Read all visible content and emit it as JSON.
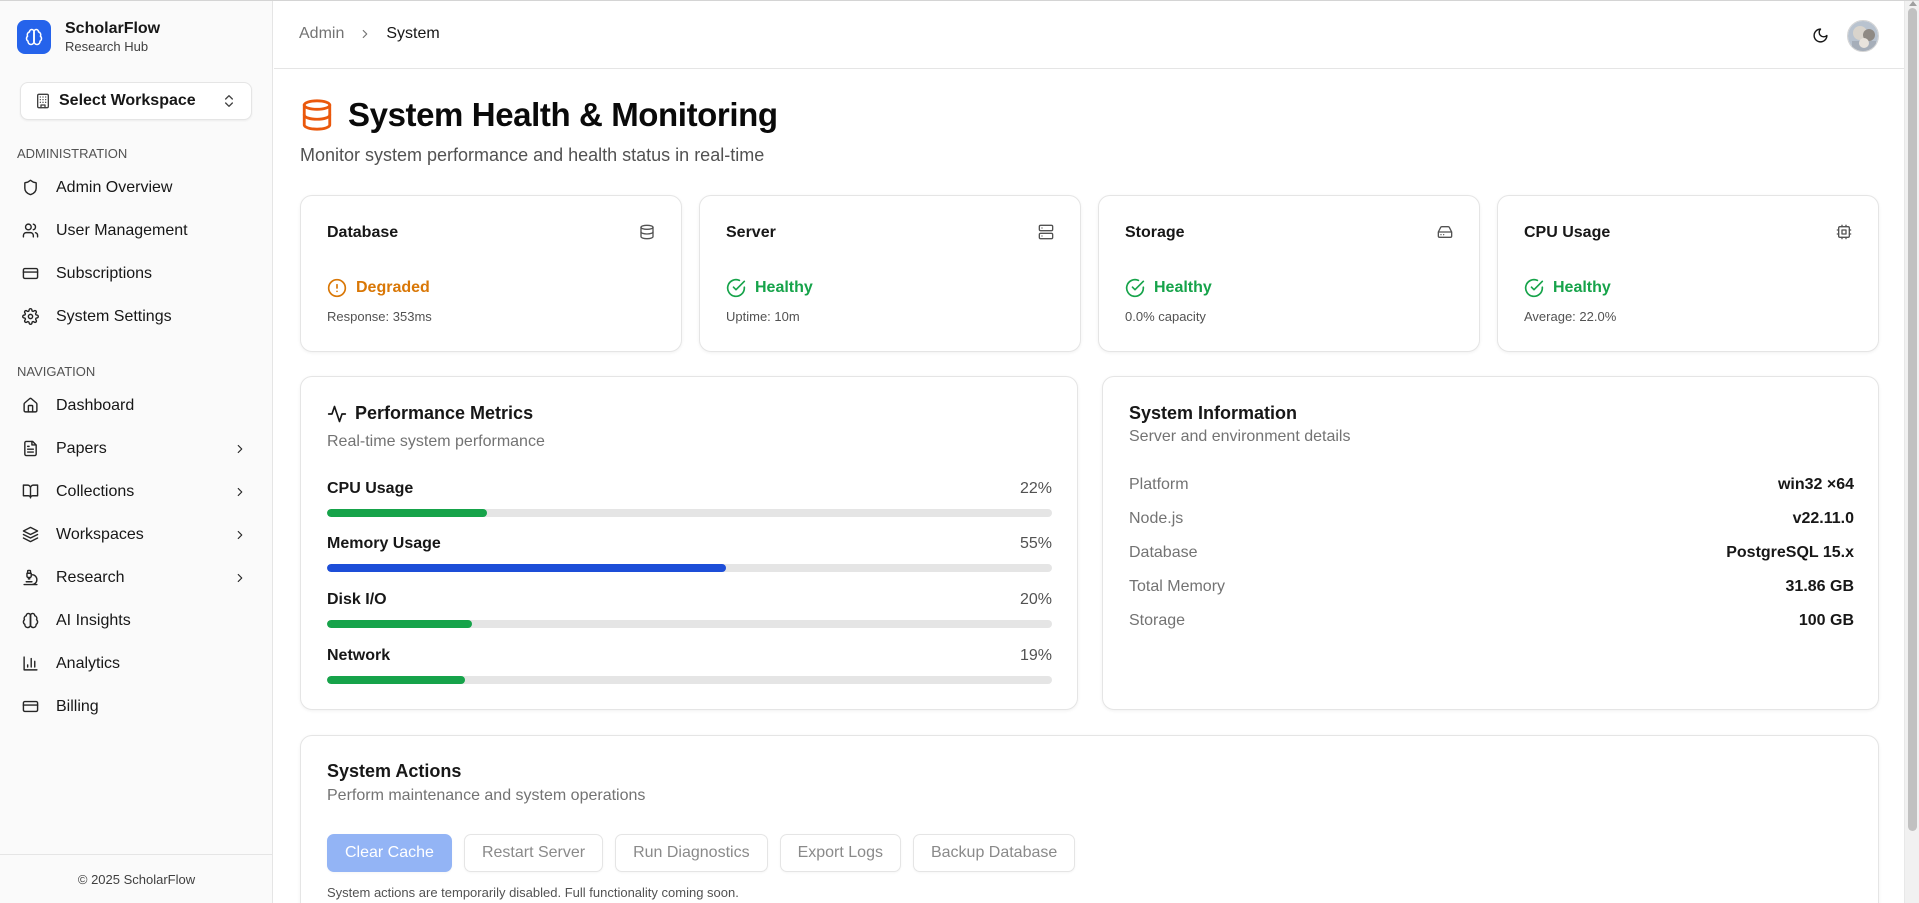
{
  "brand": {
    "name": "ScholarFlow",
    "subtitle": "Research Hub"
  },
  "workspace_select": {
    "label": "Select Workspace"
  },
  "sidebar": {
    "admin_label": "ADMINISTRATION",
    "admin_items": [
      {
        "label": "Admin Overview",
        "icon": "shield-icon"
      },
      {
        "label": "User Management",
        "icon": "users-icon"
      },
      {
        "label": "Subscriptions",
        "icon": "credit-card-icon"
      },
      {
        "label": "System Settings",
        "icon": "gear-icon"
      }
    ],
    "nav_label": "NAVIGATION",
    "nav_items": [
      {
        "label": "Dashboard",
        "icon": "home-icon"
      },
      {
        "label": "Papers",
        "icon": "file-text-icon",
        "expandable": true
      },
      {
        "label": "Collections",
        "icon": "book-open-icon",
        "expandable": true
      },
      {
        "label": "Workspaces",
        "icon": "layers-icon",
        "expandable": true
      },
      {
        "label": "Research",
        "icon": "microscope-icon",
        "expandable": true
      },
      {
        "label": "AI Insights",
        "icon": "brain-icon"
      },
      {
        "label": "Analytics",
        "icon": "bar-chart-icon"
      },
      {
        "label": "Billing",
        "icon": "credit-card-icon"
      }
    ],
    "footer": "© 2025 ScholarFlow"
  },
  "breadcrumb": {
    "parent": "Admin",
    "current": "System"
  },
  "page": {
    "title": "System Health & Monitoring",
    "subtitle": "Monitor system performance and health status in real-time"
  },
  "status_cards": [
    {
      "title": "Database",
      "icon": "database-icon",
      "status": "Degraded",
      "state": "degraded",
      "detail": "Response: 353ms"
    },
    {
      "title": "Server",
      "icon": "server-icon",
      "status": "Healthy",
      "state": "healthy",
      "detail": "Uptime: 10m"
    },
    {
      "title": "Storage",
      "icon": "hard-drive-icon",
      "status": "Healthy",
      "state": "healthy",
      "detail": "0.0% capacity"
    },
    {
      "title": "CPU Usage",
      "icon": "cpu-icon",
      "status": "Healthy",
      "state": "healthy",
      "detail": "Average: 22.0%"
    }
  ],
  "performance": {
    "title": "Performance Metrics",
    "subtitle": "Real-time system performance",
    "metrics": [
      {
        "name": "CPU Usage",
        "value_label": "22%",
        "percent": 22,
        "color": "#16a34a"
      },
      {
        "name": "Memory Usage",
        "value_label": "55%",
        "percent": 55,
        "color": "#1d4ed8"
      },
      {
        "name": "Disk I/O",
        "value_label": "20%",
        "percent": 20,
        "color": "#16a34a"
      },
      {
        "name": "Network",
        "value_label": "19%",
        "percent": 19,
        "color": "#16a34a"
      }
    ]
  },
  "system_info": {
    "title": "System Information",
    "subtitle": "Server and environment details",
    "rows": [
      {
        "key": "Platform",
        "value": "win32 ×64"
      },
      {
        "key": "Node.js",
        "value": "v22.11.0"
      },
      {
        "key": "Database",
        "value": "PostgreSQL 15.x"
      },
      {
        "key": "Total Memory",
        "value": "31.86 GB"
      },
      {
        "key": "Storage",
        "value": "100 GB"
      }
    ]
  },
  "actions": {
    "title": "System Actions",
    "subtitle": "Perform maintenance and system operations",
    "buttons": [
      "Clear Cache",
      "Restart Server",
      "Run Diagnostics",
      "Export Logs",
      "Backup Database"
    ],
    "note": "System actions are temporarily disabled. Full functionality coming soon."
  },
  "colors": {
    "accent": "#2563eb",
    "healthy": "#16a34a",
    "degraded": "#d97706",
    "title_icon": "#ea580c"
  }
}
